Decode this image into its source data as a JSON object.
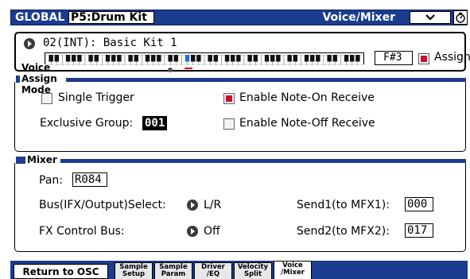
{
  "header": {
    "mode": "GLOBAL",
    "page": "P5:Drum Kit",
    "section_title": "Voice/Mixer",
    "menu_icon": "chevron-down-icon",
    "status_icon": "timer-icon"
  },
  "kit": {
    "name": "02(INT): Basic Kit 1",
    "note": "F#3",
    "assign_label": "Assign",
    "assign_checked": true
  },
  "voice_assign": {
    "title": "Voice Assign Mode",
    "single_trigger_label": "Single Trigger",
    "single_trigger_checked": false,
    "note_on_label": "Enable Note-On Receive",
    "note_on_checked": true,
    "exclusive_group_label": "Exclusive Group:",
    "exclusive_group_value": "001",
    "note_off_label": "Enable Note-Off Receive",
    "note_off_checked": false
  },
  "mixer": {
    "title": "Mixer",
    "pan_label": "Pan:",
    "pan_value": "R084",
    "bus_label": "Bus(IFX/Output)Select:",
    "bus_value": "L/R",
    "fx_label": "FX Control Bus:",
    "fx_value": "Off",
    "send1_label": "Send1(to MFX1):",
    "send1_value": "000",
    "send2_label": "Send2(to MFX2):",
    "send2_value": "017"
  },
  "tabs": {
    "return_label": "Return to OSC",
    "items": [
      {
        "line1": "Sample",
        "line2": "Setup"
      },
      {
        "line1": "Sample",
        "line2": "Param"
      },
      {
        "line1": "Driver",
        "line2": "/EQ"
      },
      {
        "line1": "Velocity",
        "line2": "Split"
      },
      {
        "line1": "Voice",
        "line2": "/Mixer"
      }
    ],
    "active_index": 4
  },
  "colors": {
    "accent": "#1b3c8f",
    "check_red": "#c8102e"
  }
}
